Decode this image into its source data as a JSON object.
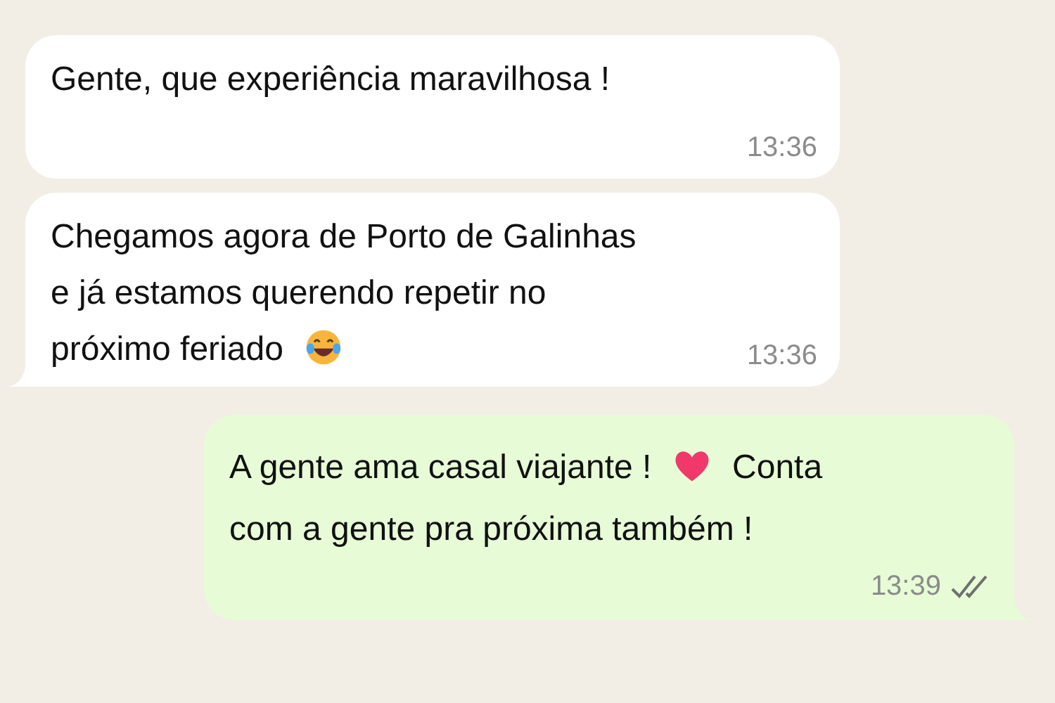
{
  "messages": [
    {
      "kind": "incoming",
      "tail": false,
      "lines": [
        [
          {
            "kind": "text",
            "text": "Gente, que experiência maravilhosa !"
          }
        ]
      ],
      "time": "13:36"
    },
    {
      "kind": "incoming",
      "tail": true,
      "lines": [
        [
          {
            "kind": "text",
            "text": "Chegamos agora de Porto de Galinhas"
          }
        ],
        [
          {
            "kind": "text",
            "text": "e já estamos querendo repetir no"
          }
        ],
        [
          {
            "kind": "text",
            "text": "próximo feriado"
          },
          {
            "kind": "laugh"
          }
        ]
      ],
      "time": "13:36"
    },
    {
      "kind": "outgoing",
      "tail": true,
      "lines": [
        [
          {
            "kind": "text",
            "text": "A gente ama casal viajante !"
          },
          {
            "kind": "heart"
          },
          {
            "kind": "text",
            "text": "Conta"
          }
        ],
        [
          {
            "kind": "text",
            "text": "com a gente pra próxima também !"
          }
        ]
      ],
      "time": "13:39",
      "read": false
    }
  ]
}
